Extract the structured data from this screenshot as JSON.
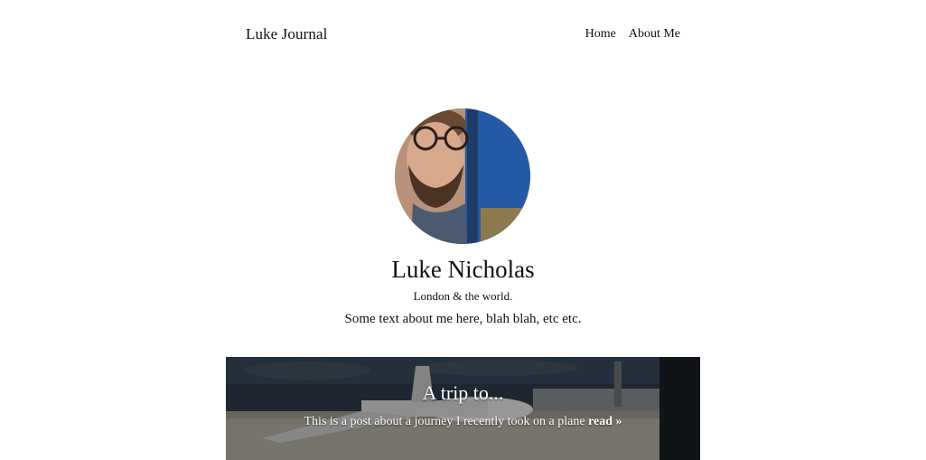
{
  "header": {
    "site_title": "Luke Journal",
    "nav": [
      {
        "label": "Home"
      },
      {
        "label": "About Me"
      }
    ]
  },
  "profile": {
    "avatar_icon": "avatar-photo",
    "name": "Luke Nicholas",
    "location": "London & the world.",
    "bio": "Some text about me here, blah blah, etc etc."
  },
  "posts": [
    {
      "title": "A trip to...",
      "excerpt": "This is a post about a journey I recently took on a plane",
      "read_more": "read »"
    }
  ],
  "colors": {
    "text": "#111111",
    "background": "#ffffff",
    "card_text": "#ffffff"
  }
}
